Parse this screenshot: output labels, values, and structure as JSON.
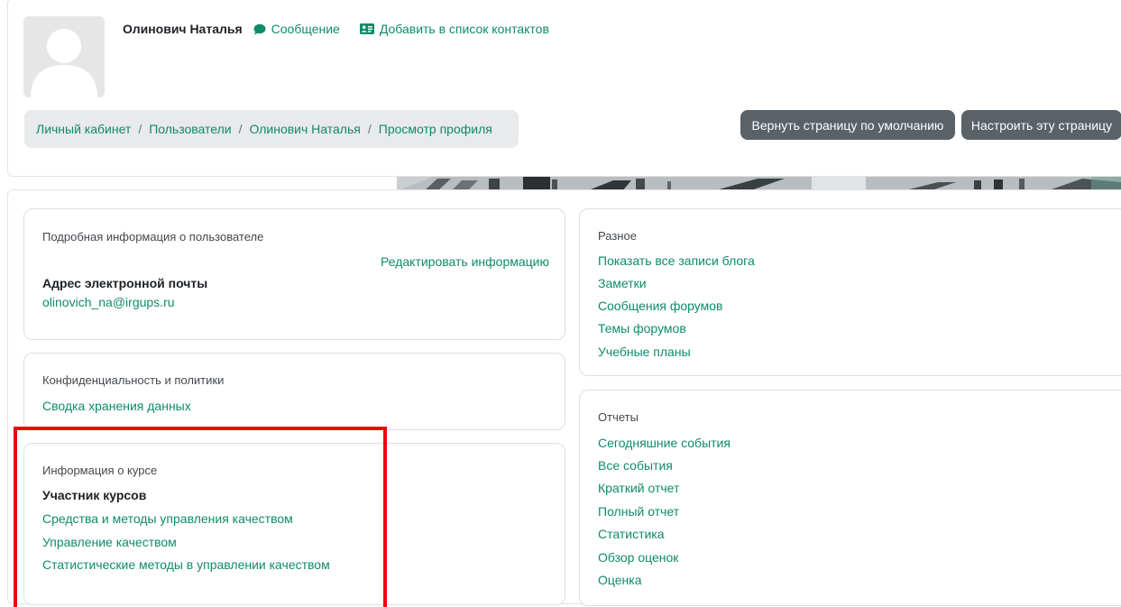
{
  "header": {
    "user_name": "Олинович Наталья",
    "message_label": "Сообщение",
    "add_contact_label": "Добавить в список контактов",
    "reset_page_label": "Вернуть страницу по умолчанию",
    "customize_page_label": "Настроить эту страницу"
  },
  "breadcrumb": {
    "items": [
      "Личный кабинет",
      "Пользователи",
      "Олинович Наталья",
      "Просмотр профиля"
    ],
    "separator": "/"
  },
  "user_details": {
    "title": "Подробная информация о пользователе",
    "edit_link": "Редактировать информацию",
    "email_label": "Адрес электронной почты",
    "email_value": "olinovich_na@irgups.ru"
  },
  "privacy": {
    "title": "Конфиденциальность и политики",
    "data_summary_link": "Сводка хранения данных"
  },
  "course_info": {
    "title": "Информация о курсе",
    "participant_label": "Участник курсов",
    "courses": [
      "Средства и методы управления качеством",
      "Управление качеством",
      "Статистические методы в управлении качеством"
    ]
  },
  "misc": {
    "title": "Разное",
    "links": [
      "Показать все записи блога",
      "Заметки",
      "Сообщения форумов",
      "Темы форумов",
      "Учебные планы"
    ]
  },
  "reports": {
    "title": "Отчеты",
    "links": [
      "Сегодняшние события",
      "Все события",
      "Краткий отчет",
      "Полный отчет",
      "Статистика",
      "Обзор оценок",
      "Оценка"
    ]
  },
  "colors": {
    "link": "#0f8b6b",
    "button_bg": "#5a6268",
    "breadcrumb_bg": "#e8eaeb",
    "highlight_border": "#e8080d"
  }
}
